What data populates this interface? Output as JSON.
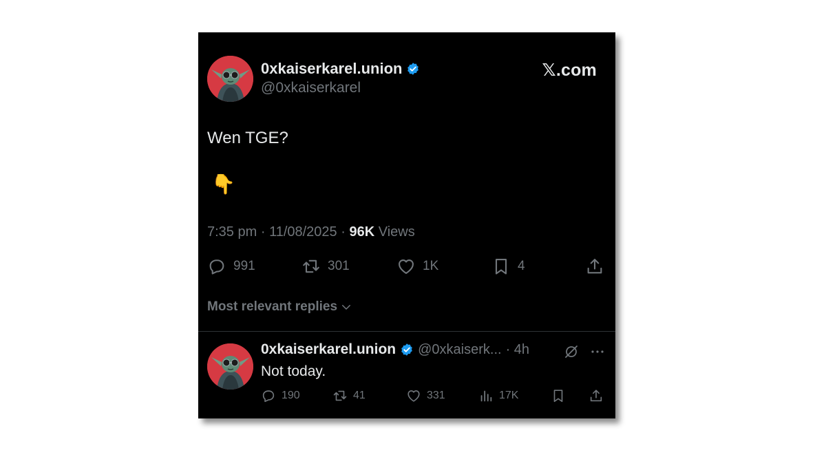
{
  "brand": {
    "label": "𝕏.com"
  },
  "post": {
    "display_name": "0xkaiserkarel.union",
    "handle": "@0xkaiserkarel",
    "text": "Wen TGE?",
    "emoji": "👇",
    "time": "7:35 pm",
    "date": "11/08/2025",
    "views_count": "96K",
    "views_label": "Views",
    "separator": "·",
    "stats": {
      "replies": "991",
      "reposts": "301",
      "likes": "1K",
      "bookmarks": "4"
    }
  },
  "replies_header": {
    "label": "Most relevant replies"
  },
  "reply": {
    "display_name": "0xkaiserkarel.union",
    "handle": "@0xkaiserk...",
    "age": "· 4h",
    "text": "Not today.",
    "stats": {
      "replies": "190",
      "reposts": "41",
      "likes": "331",
      "views": "17K"
    }
  },
  "colors": {
    "background": "#000000",
    "text": "#e7e9ea",
    "muted": "#71767b",
    "verified": "#1d9bf0",
    "avatar_bg": "#d63a43"
  }
}
